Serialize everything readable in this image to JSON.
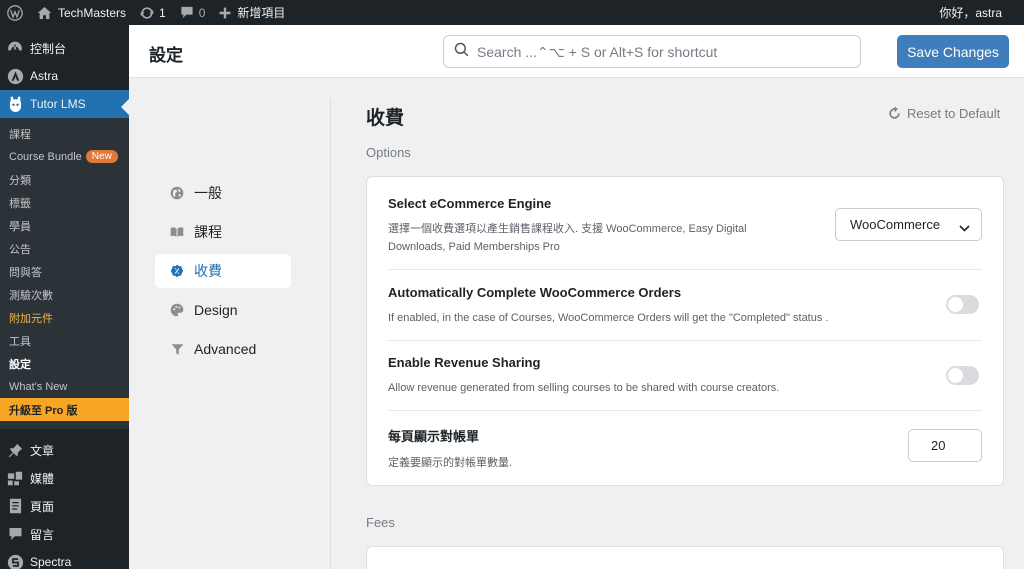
{
  "admin_bar": {
    "site_name": "TechMasters",
    "updates_count": "1",
    "comments_count": "0",
    "new_label": "新增項目",
    "greeting": "你好，astra"
  },
  "sidebar": {
    "top": [
      {
        "label": "控制台",
        "icon": "dashboard-icon"
      },
      {
        "label": "Astra",
        "icon": "astra-icon"
      },
      {
        "label": "Tutor LMS",
        "icon": "tutor-icon"
      }
    ],
    "submenu": [
      {
        "label": "課程"
      },
      {
        "label": "Course Bundle",
        "badge": "New"
      },
      {
        "label": "分類"
      },
      {
        "label": "標籤"
      },
      {
        "label": "學員"
      },
      {
        "label": "公告"
      },
      {
        "label": "問與答"
      },
      {
        "label": "測驗次數"
      },
      {
        "label": "附加元件"
      },
      {
        "label": "工具"
      },
      {
        "label": "設定"
      },
      {
        "label": "What's New"
      },
      {
        "label": "升級至 Pro 版"
      }
    ],
    "bottom": [
      {
        "label": "文章",
        "icon": "pin-icon"
      },
      {
        "label": "媒體",
        "icon": "media-icon"
      },
      {
        "label": "頁面",
        "icon": "page-icon"
      },
      {
        "label": "留言",
        "icon": "comment-icon"
      },
      {
        "label": "Spectra",
        "icon": "spectra-icon"
      }
    ]
  },
  "header": {
    "title": "設定",
    "search_placeholder": "Search ...⌃⌥ + S or Alt+S for shortcut",
    "save_label": "Save Changes"
  },
  "settings_nav": [
    {
      "label": "一般",
      "icon": "globe-icon"
    },
    {
      "label": "課程",
      "icon": "book-icon"
    },
    {
      "label": "收費",
      "icon": "payment-icon"
    },
    {
      "label": "Design",
      "icon": "palette-icon"
    },
    {
      "label": "Advanced",
      "icon": "filter-icon"
    }
  ],
  "main": {
    "section_title": "收費",
    "reset_label": "Reset to Default",
    "options_label": "Options",
    "fees_label": "Fees",
    "rows": [
      {
        "title": "Select eCommerce Engine",
        "desc": "選擇一個收費選項以產生銷售課程收入. 支援 WooCommerce, Easy Digital Downloads, Paid Memberships Pro",
        "value": "WooCommerce"
      },
      {
        "title": "Automatically Complete WooCommerce Orders",
        "desc": "If enabled, in the case of Courses, WooCommerce Orders will get the \"Completed\" status .",
        "enabled": false
      },
      {
        "title": "Enable Revenue Sharing",
        "desc": "Allow revenue generated from selling courses to be shared with course creators.",
        "enabled": false
      },
      {
        "title": "每頁顯示對帳單",
        "desc": "定義要顯示的對帳單數量.",
        "value": "20"
      }
    ]
  }
}
